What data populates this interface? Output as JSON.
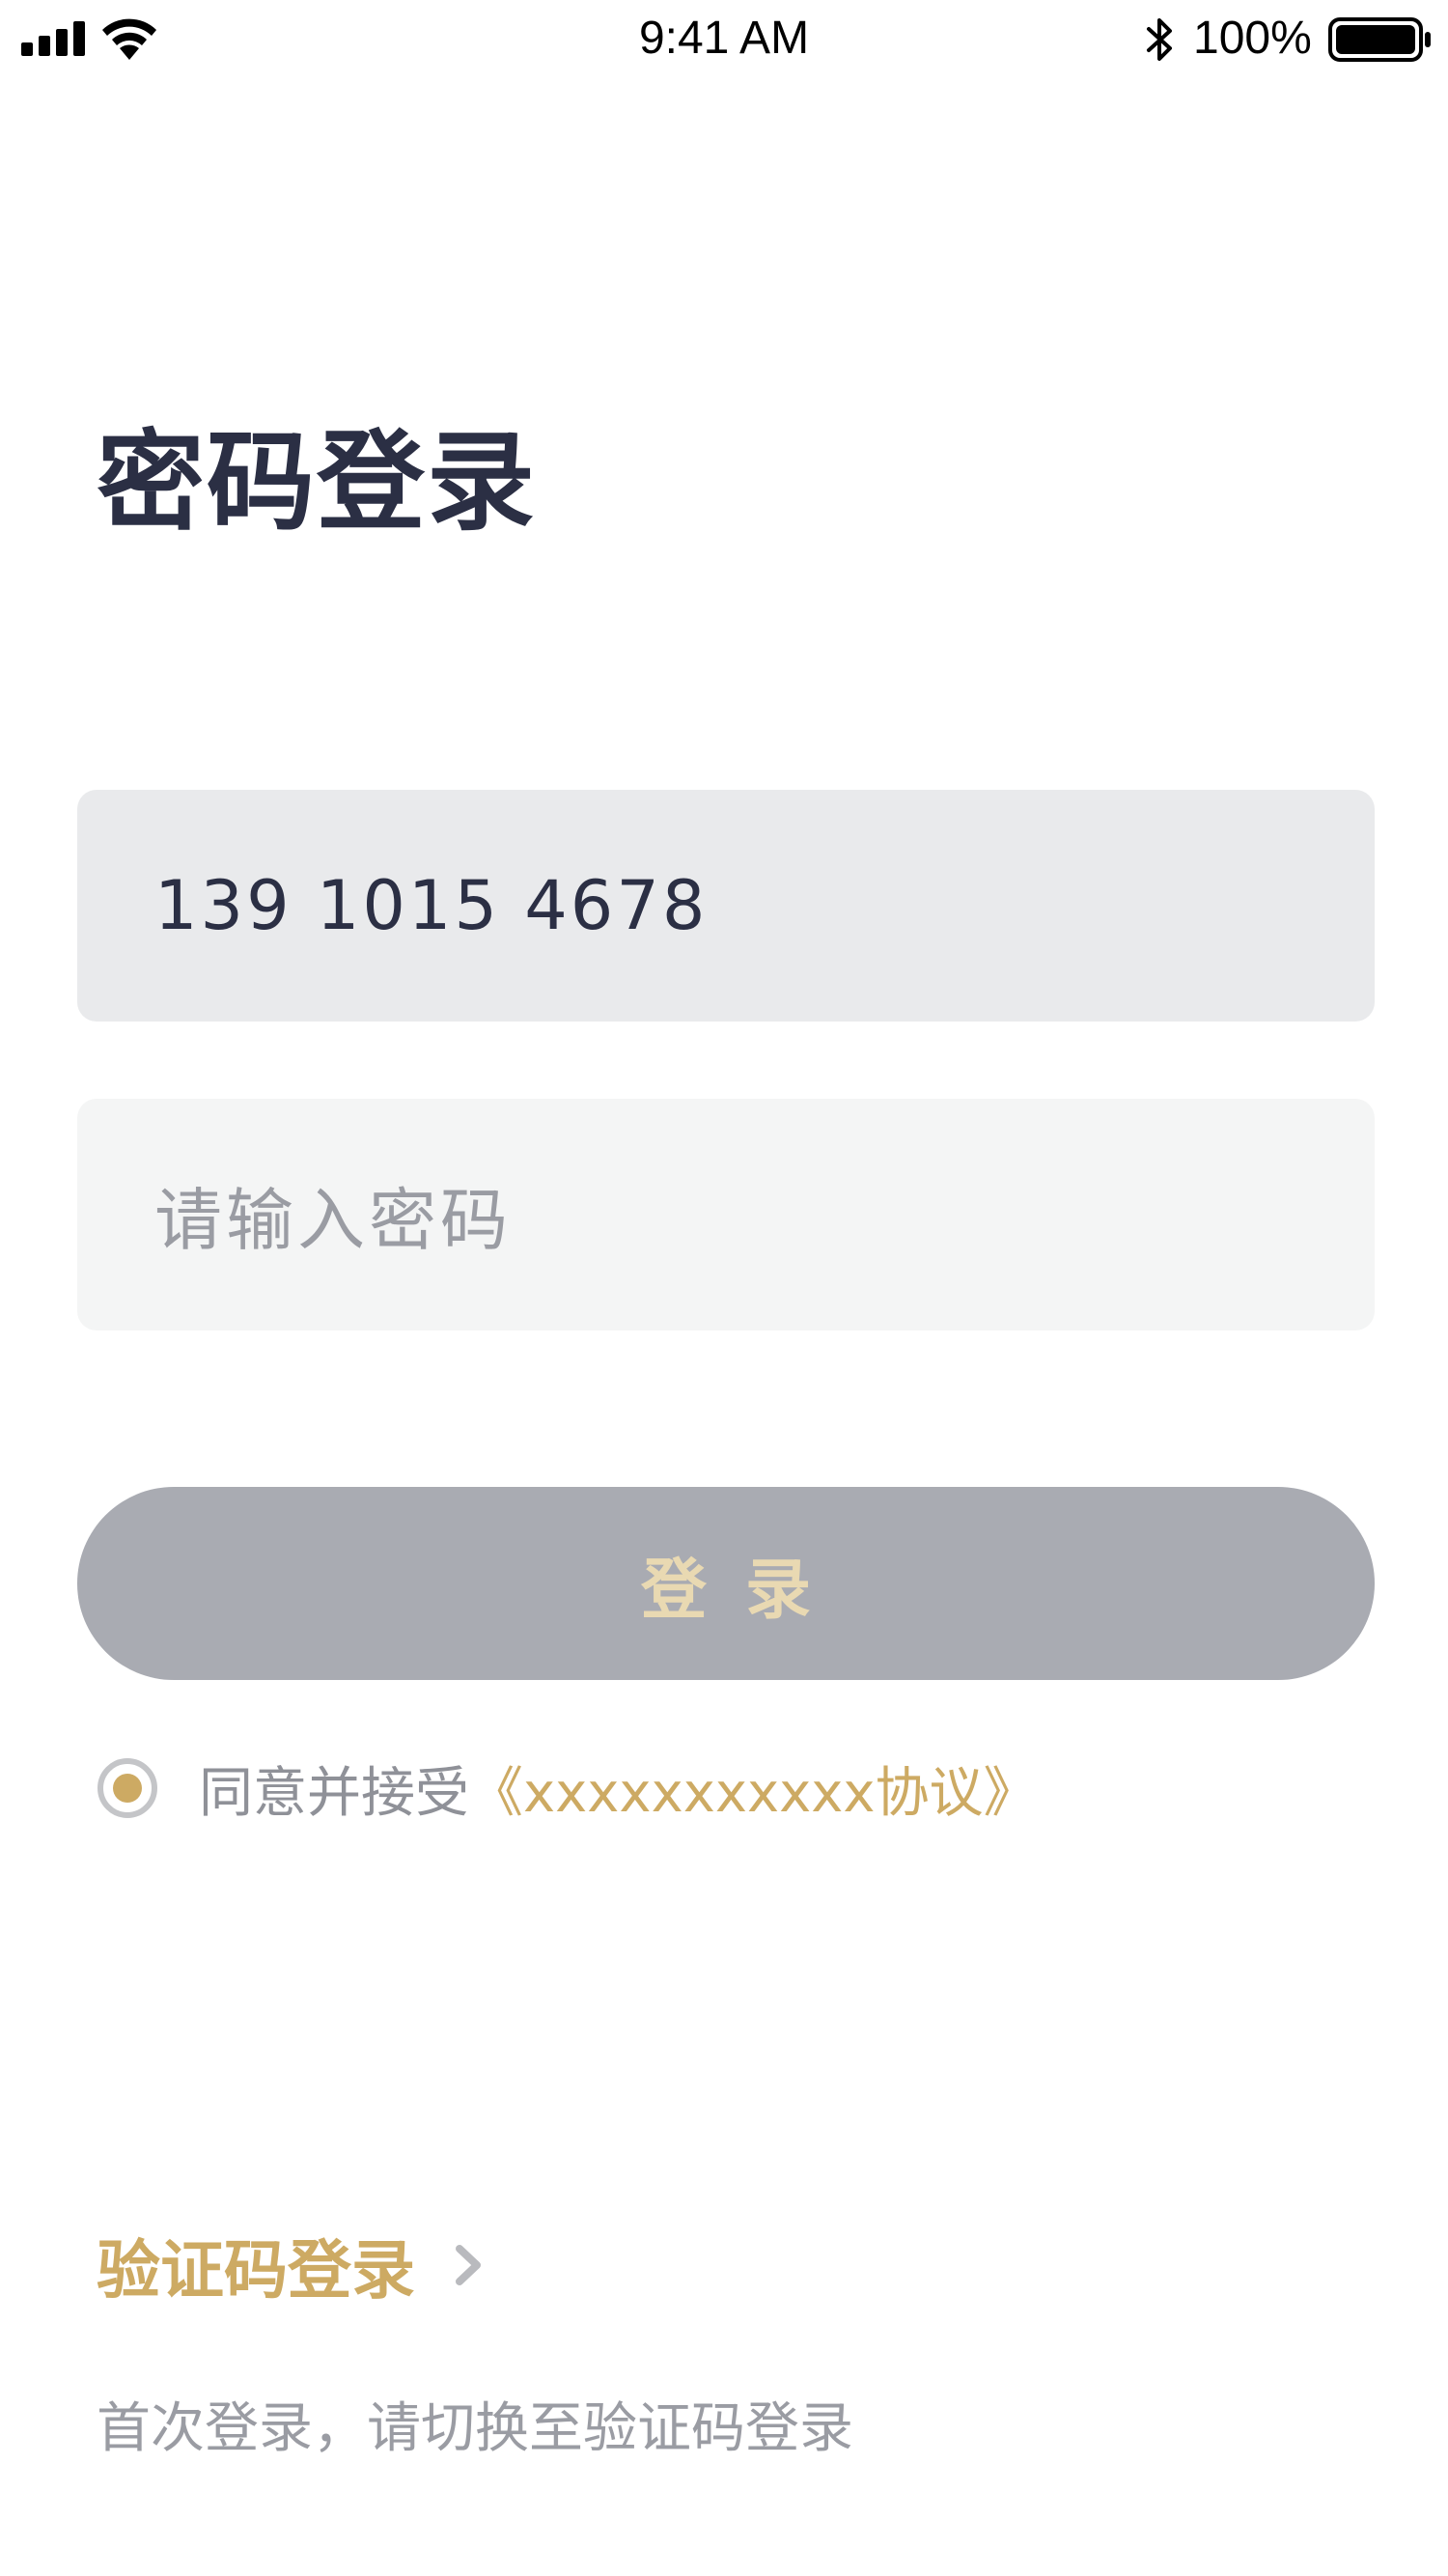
{
  "status_bar": {
    "time": "9:41 AM",
    "battery_percent": "100%",
    "icons": [
      "signal-icon",
      "wifi-icon",
      "bluetooth-icon",
      "battery-icon"
    ]
  },
  "title": "密码登录",
  "phone_field": {
    "value": "139 1015 4678"
  },
  "password_field": {
    "placeholder": "请输入密码",
    "value": ""
  },
  "login_button": {
    "label": "登录"
  },
  "agreement": {
    "text": "同意并接受",
    "link": "《xxxxxxxxxxx协议》",
    "checked": true
  },
  "sms_login": {
    "label": "验证码登录",
    "icon": "chevron-right-icon"
  },
  "hint": "首次登录，请切换至验证码登录",
  "colors": {
    "title": "#2b2f44",
    "accent_gold": "#cdaa63",
    "button_disabled": "#a9abb2",
    "button_text": "#e9d9b2",
    "field_filled": "#e9eaec",
    "field_empty": "#f4f5f5",
    "muted_text": "#9a9ca3"
  }
}
